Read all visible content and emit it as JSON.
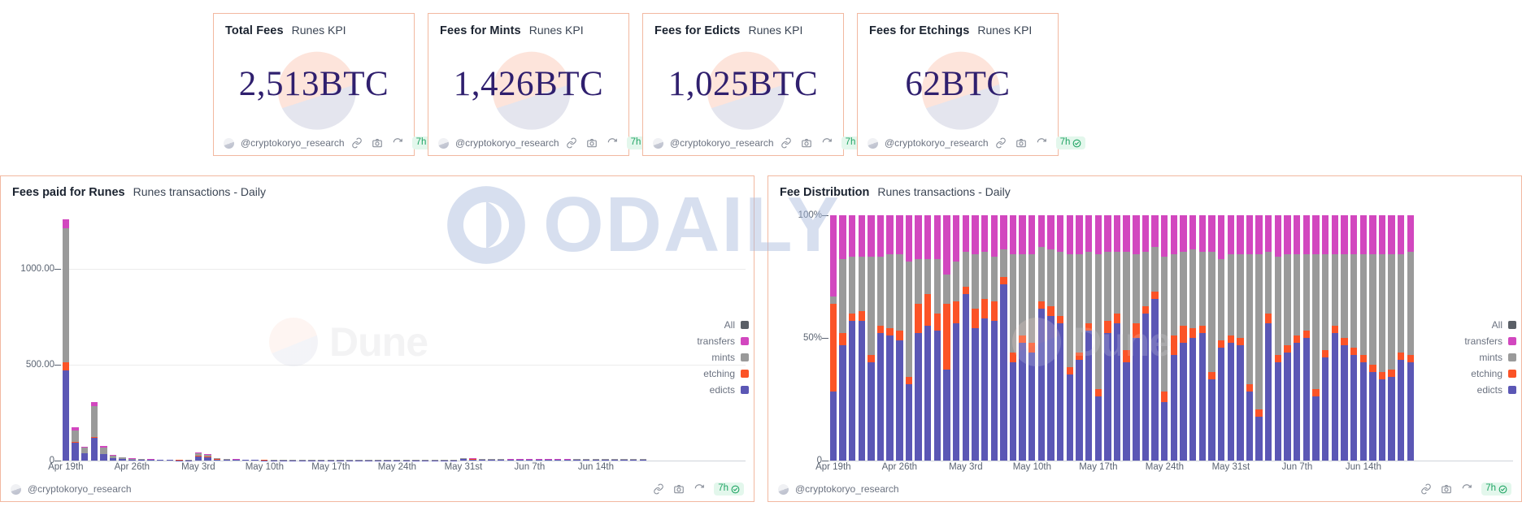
{
  "colors": {
    "border": "#f2b8a0",
    "value_text": "#2f1f6e",
    "all": "#5a5f66",
    "transfers": "#d247bf",
    "mints": "#9a9a9a",
    "etching": "#fb5327",
    "edicts": "#5b57b5",
    "badge_green": "#1fa463"
  },
  "kpis": [
    {
      "title": "Total Fees",
      "subtitle": "Runes KPI",
      "value": "2,513BTC"
    },
    {
      "title": "Fees for Mints",
      "subtitle": "Runes KPI",
      "value": "1,426BTC"
    },
    {
      "title": "Fees for Edicts",
      "subtitle": "Runes KPI",
      "value": "1,025BTC"
    },
    {
      "title": "Fees for Etchings",
      "subtitle": "Runes KPI",
      "value": "62BTC"
    }
  ],
  "footer": {
    "user": "@cryptokoryo_research",
    "refresh_badge": "7h",
    "icons": [
      "share-icon",
      "camera-icon",
      "refresh-icon",
      "check-circle-icon"
    ]
  },
  "watermarks": {
    "dune": "Dune",
    "odaily": "ODAILY"
  },
  "legend": [
    {
      "label": "All",
      "color": "#5a5f66"
    },
    {
      "label": "transfers",
      "color": "#d247bf"
    },
    {
      "label": "mints",
      "color": "#9a9a9a"
    },
    {
      "label": "etching",
      "color": "#fb5327"
    },
    {
      "label": "edicts",
      "color": "#5b57b5"
    }
  ],
  "chart_data": [
    {
      "id": "fees-paid-for-runes",
      "type": "bar",
      "stacked": true,
      "title": "Fees paid for Runes",
      "subtitle": "Runes transactions - Daily",
      "xlabel": "",
      "ylabel": "",
      "ylim": [
        0,
        1280
      ],
      "yticks": [
        0,
        500,
        1000
      ],
      "ytick_labels": [
        "0",
        "500.00",
        "1000.00"
      ],
      "grid": true,
      "legend_position": "right",
      "xtick_labels": [
        "Apr 19th",
        "Apr 26th",
        "May 3rd",
        "May 10th",
        "May 17th",
        "May 24th",
        "May 31st",
        "Jun 7th",
        "Jun 14th"
      ],
      "xtick_indices": [
        0,
        7,
        14,
        21,
        28,
        35,
        42,
        49,
        56
      ],
      "series": [
        {
          "name": "edicts",
          "color": "#5b57b5",
          "values": [
            470,
            92,
            38,
            118,
            33,
            13,
            8,
            5,
            4,
            3,
            2.5,
            2.2,
            2,
            1.8,
            22,
            18,
            6,
            4,
            3,
            2.5,
            2.2,
            2,
            1.8,
            1.6,
            1.5,
            1.4,
            1.3,
            1.2,
            1.1,
            1,
            1,
            1,
            1,
            1,
            1,
            1,
            1,
            1,
            1,
            1,
            1,
            1,
            7,
            6,
            5,
            4,
            3.5,
            3,
            3,
            3,
            3,
            3,
            3,
            3,
            4,
            4,
            4,
            4,
            4,
            4,
            4,
            4
          ]
        },
        {
          "name": "etching",
          "color": "#fb5327",
          "values": [
            42,
            4,
            2,
            4,
            2,
            1,
            0.8,
            0.6,
            0.5,
            0.4,
            0.4,
            0.3,
            0.3,
            0.3,
            1.5,
            1.2,
            0.6,
            0.4,
            0.3,
            0.3,
            0.3,
            0.3,
            0.3,
            0.3,
            0.3,
            0.3,
            0.3,
            0.3,
            0.3,
            0.3,
            0.3,
            0.3,
            0.3,
            0.3,
            0.3,
            0.3,
            0.3,
            0.3,
            0.3,
            0.3,
            0.3,
            0.3,
            0.5,
            0.5,
            0.4,
            0.4,
            0.3,
            0.3,
            0.3,
            0.3,
            0.3,
            0.3,
            0.3,
            0.3,
            0.4,
            0.4,
            0.4,
            0.4,
            0.4,
            0.4,
            0.4,
            0.4
          ]
        },
        {
          "name": "mints",
          "color": "#9a9a9a",
          "values": [
            700,
            62,
            26,
            160,
            34,
            12,
            7,
            4,
            3,
            2.5,
            2,
            1.8,
            1.6,
            1.5,
            16,
            12,
            5,
            3,
            2.5,
            2,
            1.8,
            1.6,
            1.5,
            1.4,
            1.3,
            1.2,
            1.1,
            1,
            1,
            1,
            1,
            1,
            1,
            1,
            1,
            1,
            1,
            1,
            1,
            1,
            1,
            1,
            5,
            4,
            4,
            3,
            3,
            2.5,
            2.5,
            2.5,
            2.5,
            2.5,
            2.5,
            2.5,
            3,
            3,
            3,
            3,
            3,
            3,
            3,
            3
          ]
        },
        {
          "name": "transfers",
          "color": "#d247bf",
          "values": [
            48,
            16,
            5,
            22,
            6,
            3,
            2,
            1.5,
            1.2,
            1,
            1,
            0.9,
            0.8,
            0.8,
            4,
            3,
            1.5,
            1,
            0.8,
            0.8,
            0.7,
            0.7,
            0.6,
            0.6,
            0.6,
            0.5,
            0.5,
            0.5,
            0.5,
            0.5,
            0.5,
            0.5,
            0.5,
            0.5,
            0.5,
            0.5,
            0.5,
            0.5,
            0.5,
            0.5,
            0.5,
            0.5,
            1.5,
            1.2,
            1.2,
            1,
            1,
            0.8,
            0.8,
            0.8,
            0.8,
            0.8,
            0.8,
            0.8,
            1,
            1,
            1,
            1,
            1,
            1,
            1,
            1
          ]
        }
      ]
    },
    {
      "id": "fee-distribution",
      "type": "bar",
      "stacked": true,
      "normalized": true,
      "title": "Fee Distribution",
      "subtitle": "Runes transactions - Daily",
      "xlabel": "",
      "ylabel": "",
      "ylim": [
        0,
        100
      ],
      "yticks": [
        0,
        50,
        100
      ],
      "ytick_labels": [
        "0",
        "50%",
        "100%"
      ],
      "grid": false,
      "legend_position": "right",
      "xtick_labels": [
        "Apr 19th",
        "Apr 26th",
        "May 3rd",
        "May 10th",
        "May 17th",
        "May 24th",
        "May 31st",
        "Jun 7th",
        "Jun 14th"
      ],
      "xtick_indices": [
        0,
        7,
        14,
        21,
        28,
        35,
        42,
        49,
        56
      ],
      "series": [
        {
          "name": "edicts",
          "color": "#5b57b5",
          "values": [
            28,
            47,
            57,
            57,
            40,
            52,
            51,
            49,
            31,
            52,
            55,
            53,
            37,
            56,
            68,
            54,
            58,
            57,
            72,
            40,
            48,
            44,
            62,
            59,
            56,
            35,
            41,
            53,
            26,
            52,
            56,
            40,
            50,
            60,
            66,
            24,
            43,
            48,
            50,
            52,
            33,
            46,
            48,
            47,
            28,
            18,
            56,
            40,
            44,
            48,
            50,
            26,
            42,
            52,
            47,
            43,
            40,
            36,
            33,
            34,
            41,
            40
          ]
        },
        {
          "name": "etching",
          "color": "#fb5327",
          "values": [
            36,
            5,
            3,
            4,
            3,
            3,
            3,
            4,
            3,
            12,
            13,
            7,
            27,
            9,
            3,
            8,
            8,
            8,
            3,
            4,
            3,
            4,
            3,
            4,
            3,
            3,
            3,
            3,
            3,
            5,
            4,
            5,
            6,
            3,
            3,
            4,
            8,
            7,
            4,
            3,
            3,
            3,
            3,
            3,
            3,
            3,
            4,
            3,
            3,
            3,
            3,
            3,
            3,
            3,
            3,
            3,
            3,
            3,
            3,
            3,
            3,
            3
          ]
        },
        {
          "name": "mints",
          "color": "#9a9a9a",
          "values": [
            3,
            30,
            23,
            22,
            40,
            28,
            30,
            31,
            47,
            18,
            14,
            22,
            12,
            16,
            14,
            22,
            19,
            18,
            11,
            40,
            33,
            36,
            22,
            23,
            26,
            46,
            40,
            29,
            55,
            28,
            25,
            40,
            28,
            22,
            18,
            55,
            33,
            30,
            32,
            30,
            49,
            33,
            33,
            34,
            53,
            63,
            25,
            40,
            37,
            33,
            31,
            55,
            39,
            29,
            34,
            38,
            41,
            45,
            48,
            47,
            40,
            42
          ]
        },
        {
          "name": "transfers",
          "color": "#d247bf",
          "values": [
            33,
            18,
            17,
            17,
            17,
            17,
            16,
            16,
            19,
            18,
            18,
            18,
            24,
            19,
            15,
            16,
            15,
            17,
            14,
            16,
            16,
            16,
            13,
            14,
            15,
            16,
            16,
            15,
            16,
            15,
            15,
            15,
            16,
            15,
            13,
            17,
            16,
            15,
            14,
            15,
            15,
            18,
            16,
            16,
            16,
            16,
            15,
            17,
            16,
            16,
            16,
            16,
            16,
            16,
            16,
            16,
            16,
            16,
            16,
            16,
            16,
            15
          ]
        }
      ]
    }
  ]
}
